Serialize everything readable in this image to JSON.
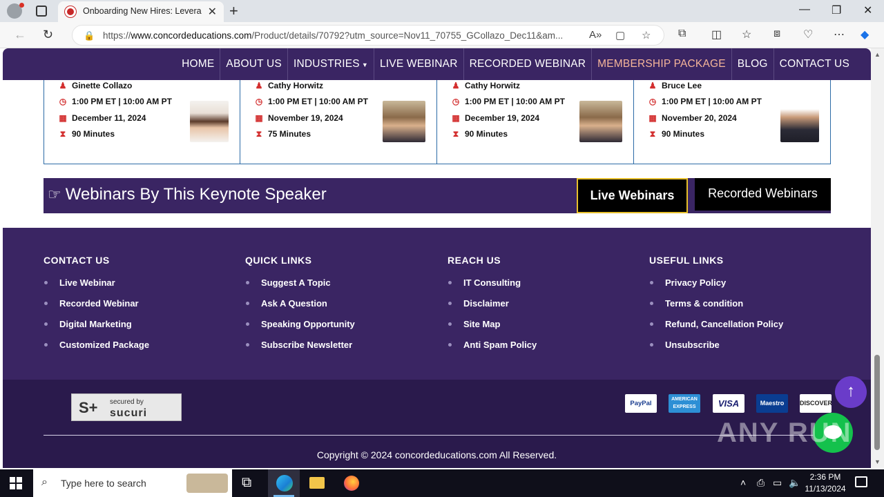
{
  "browser": {
    "tab_title": "Onboarding New Hires: Leverage",
    "url_prefix": "https://",
    "url_domain": "www.concordeducations.com",
    "url_rest": "/Product/details/70792?utm_source=Nov11_70755_GCollazo_Dec11&am..."
  },
  "nav": {
    "items": [
      "HOME",
      "ABOUT US",
      "INDUSTRIES",
      "LIVE WEBINAR",
      "RECORDED WEBINAR",
      "MEMBERSHIP PACKAGE",
      "BLOG",
      "CONTACT US"
    ],
    "highlight_color": "#f6b69a"
  },
  "cards": [
    {
      "speaker": "Ginette Collazo",
      "time": "1:00 PM ET | 10:00 AM PT",
      "date": "December 11, 2024",
      "duration": "90 Minutes"
    },
    {
      "speaker": "Cathy Horwitz",
      "time": "1:00 PM ET | 10:00 AM PT",
      "date": "November 19, 2024",
      "duration": "75 Minutes"
    },
    {
      "speaker": "Cathy Horwitz",
      "time": "1:00 PM ET | 10:00 AM PT",
      "date": "December 19, 2024",
      "duration": "90 Minutes"
    },
    {
      "speaker": "Bruce Lee",
      "time": "1:00 PM ET | 10:00 AM PT",
      "date": "November 20, 2024",
      "duration": "90 Minutes"
    }
  ],
  "keynote": {
    "title": "Webinars By This Keynote Speaker",
    "live_btn": "Live Webinars",
    "recorded_btn": "Recorded Webinars"
  },
  "footer": {
    "columns": [
      {
        "heading": "CONTACT US",
        "links": [
          "Live Webinar",
          "Recorded Webinar",
          "Digital Marketing",
          "Customized Package"
        ]
      },
      {
        "heading": "QUICK LINKS",
        "links": [
          "Suggest A Topic",
          "Ask A Question",
          "Speaking Opportunity",
          "Subscribe Newsletter"
        ]
      },
      {
        "heading": "REACH US",
        "links": [
          "IT Consulting",
          "Disclaimer",
          "Site Map",
          "Anti Spam Policy"
        ]
      },
      {
        "heading": "USEFUL LINKS",
        "links": [
          "Privacy Policy",
          "Terms & condition",
          "Refund, Cancellation Policy",
          "Unsubscribe"
        ]
      }
    ],
    "sucuri_small": "secured by",
    "sucuri_big": "sucuri",
    "payments": [
      "PayPal",
      "AMERICAN EXPRESS",
      "VISA",
      "Maestro",
      "DISCOVER"
    ],
    "copyright": "Copyright © 2024 concordeducations.com All Reserved."
  },
  "watermark": "ANY RUN",
  "taskbar": {
    "search_placeholder": "Type here to search",
    "time": "2:36 PM",
    "date": "11/13/2024"
  },
  "colors": {
    "brand_purple": "#3a2563",
    "accent_gold": "#e8c02a",
    "icon_red": "#d32f2f"
  }
}
